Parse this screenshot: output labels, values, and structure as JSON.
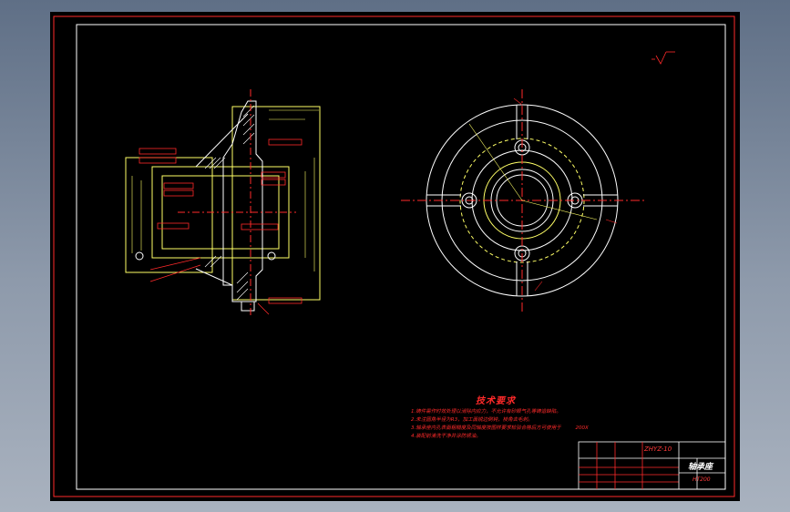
{
  "drawing": {
    "tech_requirements_title": "技术要求",
    "notes": [
      "1.铸件需作时效处理以消除内应力，不允许有砂眼气孔等铸造缺陷。",
      "2.未注圆角半径为R3，加工面锐边倒钝，棱角去毛刺。",
      "3.轴承座内孔表面粗糙度及同轴度按图样要求检验合格后方可使用于",
      "4.装配前清洗干净并涂防锈油。"
    ],
    "note3_suffix": "200X",
    "title_block": {
      "drawing_no": "ZHYZ-10",
      "part_name": "轴承座",
      "material": "HT200"
    }
  },
  "colors": {
    "background": "#000000",
    "border": "#ff2a2a",
    "geometry": "#ffff66",
    "annotation": "#ff2a2a",
    "outline": "#ffffff"
  }
}
